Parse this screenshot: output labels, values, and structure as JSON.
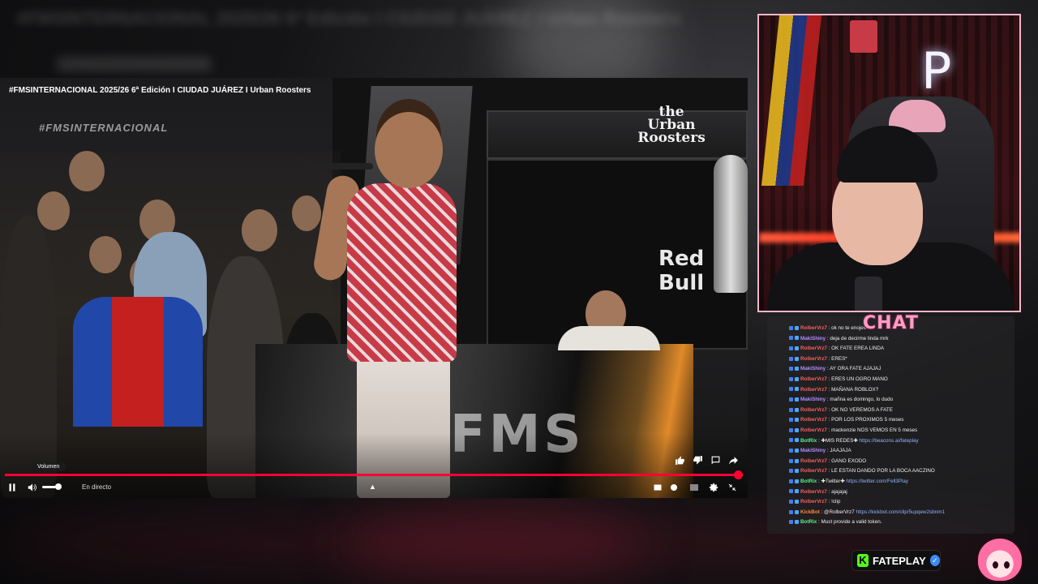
{
  "video": {
    "title": "#FMSINTERNACIONAL 2025/26 6ª Edición I CIUDAD JUÁREZ I Urban Roosters",
    "watermark": "#FMSINTERNACIONAL",
    "stage_logo": "the Urban Roosters",
    "sponsor": "Red Bull",
    "screen_logo": "FMS",
    "progress": 0.995,
    "volume_tooltip": "Volumen",
    "live_label": "En directo",
    "accent_color": "#ff0033"
  },
  "chat": {
    "header": "CHAT",
    "messages": [
      {
        "user": "RolberVrz7",
        "color": "#ff5c5c",
        "text": "ok no te enojes 7"
      },
      {
        "user": "MakiShiny",
        "color": "#b68cff",
        "text": "deja de decirme linda mrk"
      },
      {
        "user": "RolberVrz7",
        "color": "#ff5c5c",
        "text": "OK FATE EREA LINDA"
      },
      {
        "user": "RolberVrz7",
        "color": "#ff5c5c",
        "text": "ERES*"
      },
      {
        "user": "MakiShiny",
        "color": "#b68cff",
        "text": "AY ORA FATE AJAJAJ"
      },
      {
        "user": "RolberVrz7",
        "color": "#ff5c5c",
        "text": "ERES UN OGRO MANO"
      },
      {
        "user": "RolberVrz7",
        "color": "#ff5c5c",
        "text": "MAÑANA ROBLOX?"
      },
      {
        "user": "MakiShiny",
        "color": "#b68cff",
        "text": "mañna es domingo, lo dudo"
      },
      {
        "user": "RolberVrz7",
        "color": "#ff5c5c",
        "text": "OK NO VEREMOS A FATE"
      },
      {
        "user": "RolberVrz7",
        "color": "#ff5c5c",
        "text": "POR LOS PROXIMOS 5 meses"
      },
      {
        "user": "RolberVrz7",
        "color": "#ff5c5c",
        "text": "mackenzie NOS VEMOS EN 5 meses"
      },
      {
        "user": "BotRix",
        "color": "#5cf08a",
        "text": "✚MIS REDES✚ ",
        "link": "https://beacons.ai/fateplay"
      },
      {
        "user": "MakiShiny",
        "color": "#b68cff",
        "text": "JAAJAJA"
      },
      {
        "user": "RolberVrz7",
        "color": "#ff5c5c",
        "text": "GANO EXODO"
      },
      {
        "user": "RolberVrz7",
        "color": "#ff5c5c",
        "text": "LE ESTAN DANDO POR LA BOCA AACZINO"
      },
      {
        "user": "BotRix",
        "color": "#5cf08a",
        "text": "✚Twitter✚ ",
        "link": "https://twitter.com/Fell3Play"
      },
      {
        "user": "RolberVrz7",
        "color": "#ff5c5c",
        "text": "ajajajaj"
      },
      {
        "user": "RolberVrz7",
        "color": "#ff5c5c",
        "text": "!clip"
      },
      {
        "user": "KickBot",
        "color": "#ff8a3c",
        "text": "@RolberVrz7 ",
        "link": "https://kickbot.com/clip/5upqew2sbnm1"
      },
      {
        "user": "BotRix",
        "color": "#5cf08a",
        "text": "Must provide a valid token."
      }
    ]
  },
  "branding": {
    "kick_letter": "K",
    "channel_name": "FATEPLAY",
    "verified_mark": "✓",
    "kick_color": "#53fc18"
  },
  "background": {
    "blurred_title": "#FMSINTERNACIONAL 2025/26 6ª Edición I CIUDAD JUÁREZ I Urban Roosters"
  }
}
